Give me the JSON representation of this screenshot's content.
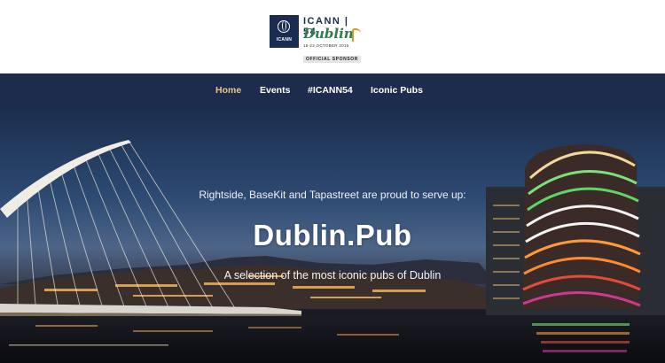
{
  "logo": {
    "box_text": "ICANN",
    "title": "ICANN | 54",
    "city": "Dublin",
    "date": "18-22 OCTOBER 2015",
    "sponsor": "OFFICIAL SPONSOR",
    "harp_icon": "harp-icon",
    "globe_icon": "globe-icon"
  },
  "nav": {
    "items": [
      {
        "label": "Home",
        "active": true
      },
      {
        "label": "Events",
        "active": false
      },
      {
        "label": "#ICANN54",
        "active": false
      },
      {
        "label": "Iconic Pubs",
        "active": false
      }
    ]
  },
  "hero": {
    "intro": "Rightside, BaseKit and Tapastreet are proud to serve up:",
    "title": "Dublin.Pub",
    "subtitle": "A selection of the most iconic pubs of Dublin"
  },
  "colors": {
    "nav_bg": "#1d2b4c",
    "nav_active": "#e6c58c",
    "logo_navy": "#1b2c52",
    "logo_green": "#2e7d4a"
  }
}
